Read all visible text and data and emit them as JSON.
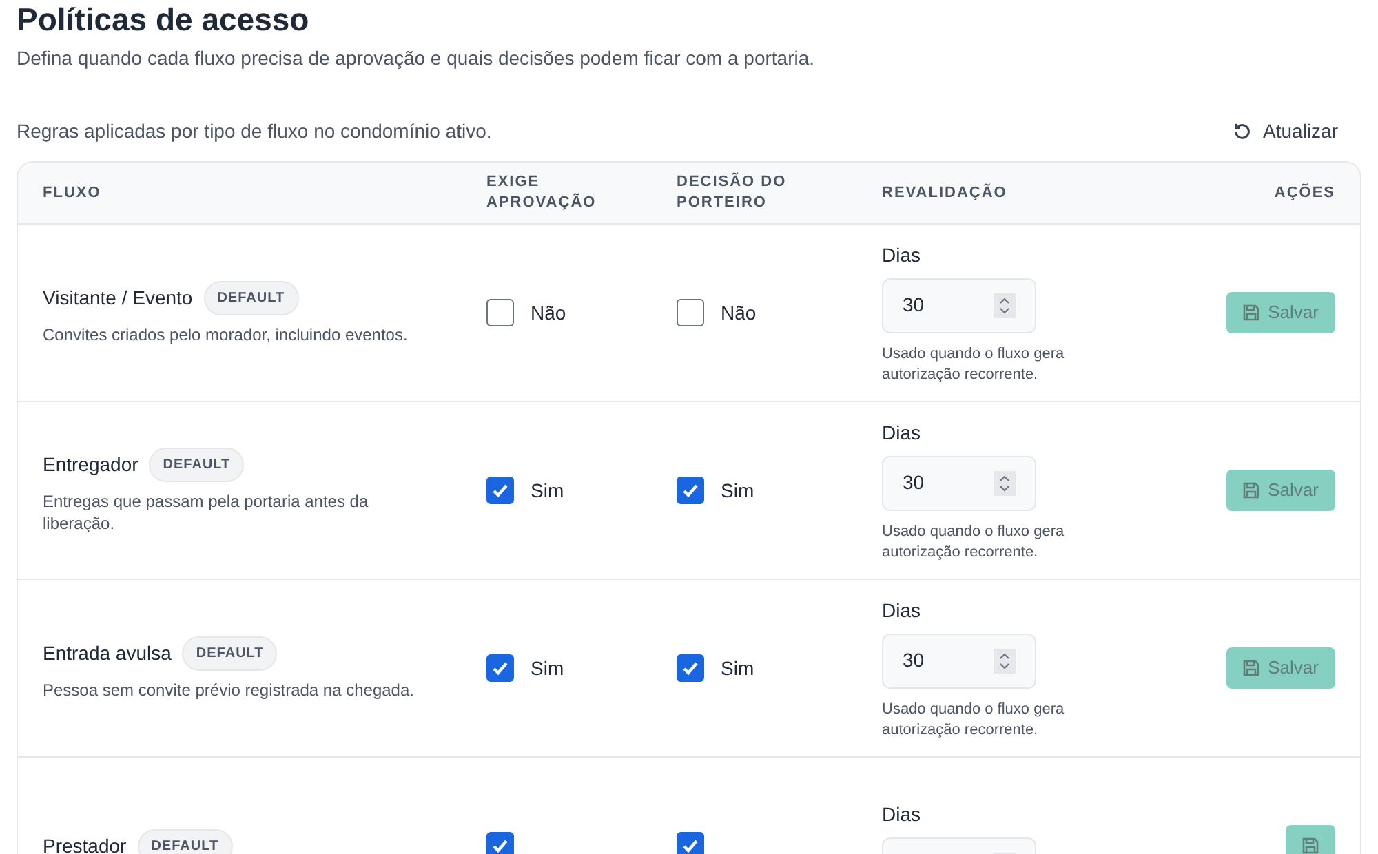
{
  "page": {
    "title": "Políticas de acesso",
    "subtitle": "Defina quando cada fluxo precisa de aprovação e quais decisões podem ficar com a portaria."
  },
  "toolbar": {
    "caption": "Regras aplicadas por tipo de fluxo no condomínio ativo.",
    "refresh_button": "Atualizar"
  },
  "table": {
    "columns": [
      "FLUXO",
      "EXIGE APROVAÇÃO",
      "DECISÃO DO PORTEIRO",
      "REVALIDAÇÃO",
      "AÇÕES"
    ],
    "rows": [
      {
        "name": "Visitante / Evento",
        "badge": "DEFAULT",
        "description": "Convites criados pelo morador, incluindo eventos.",
        "requires_approval": {
          "checked": false,
          "label": "Não"
        },
        "doorman_decision": {
          "checked": false,
          "label": "Não"
        },
        "days_label": "Dias",
        "days_value": "30",
        "hint": "Usado quando o fluxo gera autorização recorrente.",
        "save_button": "Salvar",
        "save_disabled": true
      },
      {
        "name": "Entregador",
        "badge": "DEFAULT",
        "description": "Entregas que passam pela portaria antes da liberação.",
        "requires_approval": {
          "checked": true,
          "label": "Sim"
        },
        "doorman_decision": {
          "checked": true,
          "label": "Sim"
        },
        "days_label": "Dias",
        "days_value": "30",
        "hint": "Usado quando o fluxo gera autorização recorrente.",
        "save_button": "Salvar",
        "save_disabled": true
      },
      {
        "name": "Entrada avulsa",
        "badge": "DEFAULT",
        "description": "Pessoa sem convite prévio registrada na chegada.",
        "requires_approval": {
          "checked": true,
          "label": "Sim"
        },
        "doorman_decision": {
          "checked": true,
          "label": "Sim"
        },
        "days_label": "Dias",
        "days_value": "30",
        "hint": "Usado quando o fluxo gera autorização recorrente.",
        "save_button": "Salvar",
        "save_disabled": true
      },
      {
        "name": "Prestador",
        "badge": "DEFAULT",
        "requires_approval": {
          "checked": true
        },
        "doorman_decision": {
          "checked": true
        },
        "days_label": "Dias",
        "save_disabled": true
      }
    ]
  }
}
